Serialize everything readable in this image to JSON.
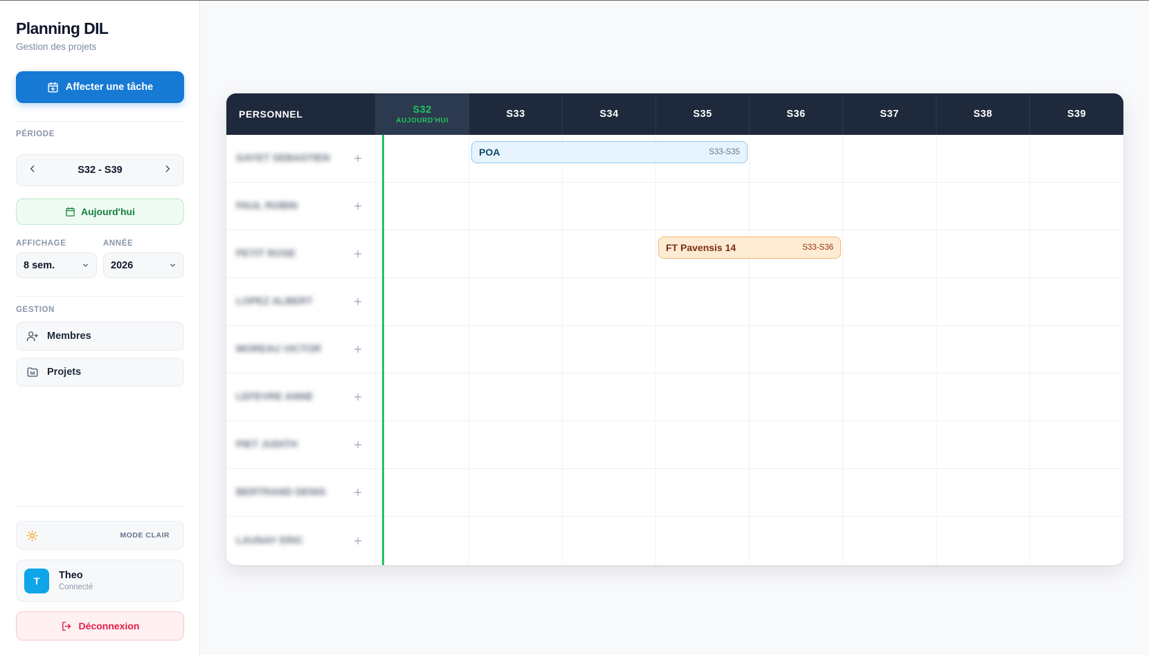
{
  "app": {
    "title": "Planning DIL",
    "subtitle": "Gestion des projets"
  },
  "sidebar": {
    "assign_button": "Affecter une tâche",
    "period_label": "PÉRIODE",
    "period_value": "S32 - S39",
    "today_button": "Aujourd'hui",
    "display_label": "AFFICHAGE",
    "display_value": "8 sem.",
    "year_label": "ANNÉE",
    "year_value": "2026",
    "management_label": "GESTION",
    "nav": {
      "members": "Membres",
      "projects": "Projets"
    },
    "mode_label": "MODE CLAIR",
    "user": {
      "initial": "T",
      "name": "Theo",
      "status": "Connecté"
    },
    "logout_button": "Déconnexion"
  },
  "planning": {
    "personnel_header": "PERSONNEL",
    "today_tag": "AUJOURD'HUI",
    "weeks": [
      "S32",
      "S33",
      "S34",
      "S35",
      "S36",
      "S37",
      "S38",
      "S39"
    ],
    "current_week": "S32",
    "rows": [
      {
        "name": "GAYET SEBASTIEN"
      },
      {
        "name": "PAUL ROBIN"
      },
      {
        "name": "PETIT ROSE"
      },
      {
        "name": "LOPEZ ALBERT"
      },
      {
        "name": "MOREAU VICTOR"
      },
      {
        "name": "LEFEVRE ANNE"
      },
      {
        "name": "PIET JUDITH"
      },
      {
        "name": "BERTRAND DENIS"
      },
      {
        "name": "LAUNAY ERIC"
      }
    ],
    "tasks": [
      {
        "name": "POA",
        "range": "S33-S35",
        "row": 0,
        "start_week": "S33",
        "end_week": "S35",
        "color": "blue"
      },
      {
        "name": "FT Pavensis 14",
        "range": "S33-S36",
        "row": 2,
        "start_week": "S35",
        "end_week": "S36",
        "color": "orange"
      }
    ]
  },
  "colors": {
    "primary": "#1679d3",
    "header_dark": "#1e293b",
    "today_green": "#22c55e",
    "danger": "#e11d48"
  }
}
